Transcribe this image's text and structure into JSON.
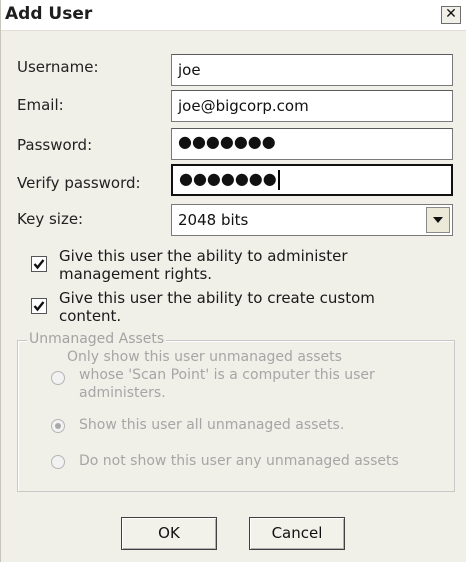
{
  "dialog": {
    "title": "Add User",
    "close_glyph": "✕"
  },
  "form": {
    "username_label": "Username:",
    "username_value": "joe",
    "email_label": "Email:",
    "email_value": "joe@bigcorp.com",
    "password_label": "Password:",
    "password_mask": "●●●●●●●",
    "verify_label": "Verify password:",
    "verify_mask": "●●●●●●●",
    "keysize_label": "Key size:",
    "keysize_value": "2048 bits"
  },
  "options": {
    "admin_rights_line1": "Give this user the ability to administer",
    "admin_rights_line2": "management rights.",
    "admin_rights_checked": true,
    "custom_content_line1": "Give this user the ability to create custom",
    "custom_content_line2": "content.",
    "custom_content_checked": true
  },
  "unmanaged": {
    "legend": "Unmanaged Assets",
    "option1_line1": "Only show this user unmanaged assets",
    "option1_line2": "whose 'Scan Point' is a computer this user",
    "option1_line3": "administers.",
    "option2": "Show this user all unmanaged assets.",
    "option3": "Do not show this user any unmanaged assets",
    "selected_option": 2
  },
  "buttons": {
    "ok": "OK",
    "cancel": "Cancel"
  },
  "icons": {
    "close": "close-icon",
    "dropdown": "chevron-down-icon",
    "check": "checkmark-icon"
  }
}
